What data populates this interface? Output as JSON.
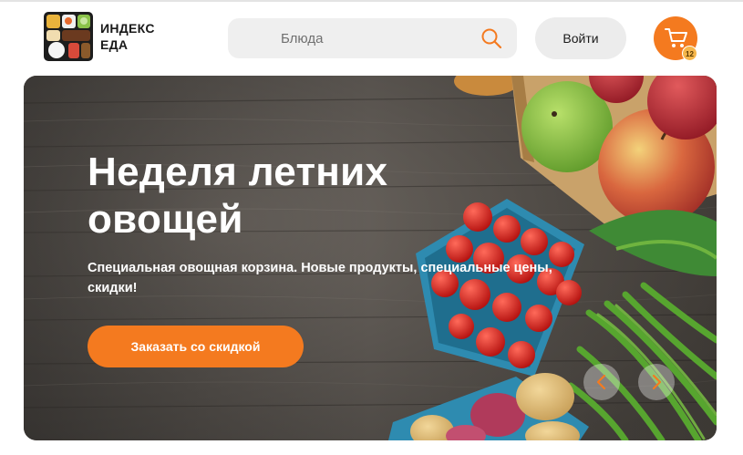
{
  "header": {
    "logo": {
      "line1": "ИНДЕКС",
      "line2": "ЕДА"
    },
    "search": {
      "placeholder": "Блюда",
      "icon": "search-icon"
    },
    "login_label": "Войти",
    "cart": {
      "icon": "cart-icon",
      "count": "12"
    }
  },
  "banner": {
    "title": "Неделя летних овощей",
    "subtitle": "Специальная овощная корзина. Новые продукты, специальные цены, скидки!",
    "cta_label": "Заказать со скидкой",
    "prev_icon": "chevron-left-icon",
    "next_icon": "chevron-right-icon"
  },
  "colors": {
    "accent": "#f47a1f",
    "badge": "#f6b64b",
    "input_bg": "#efefef"
  }
}
